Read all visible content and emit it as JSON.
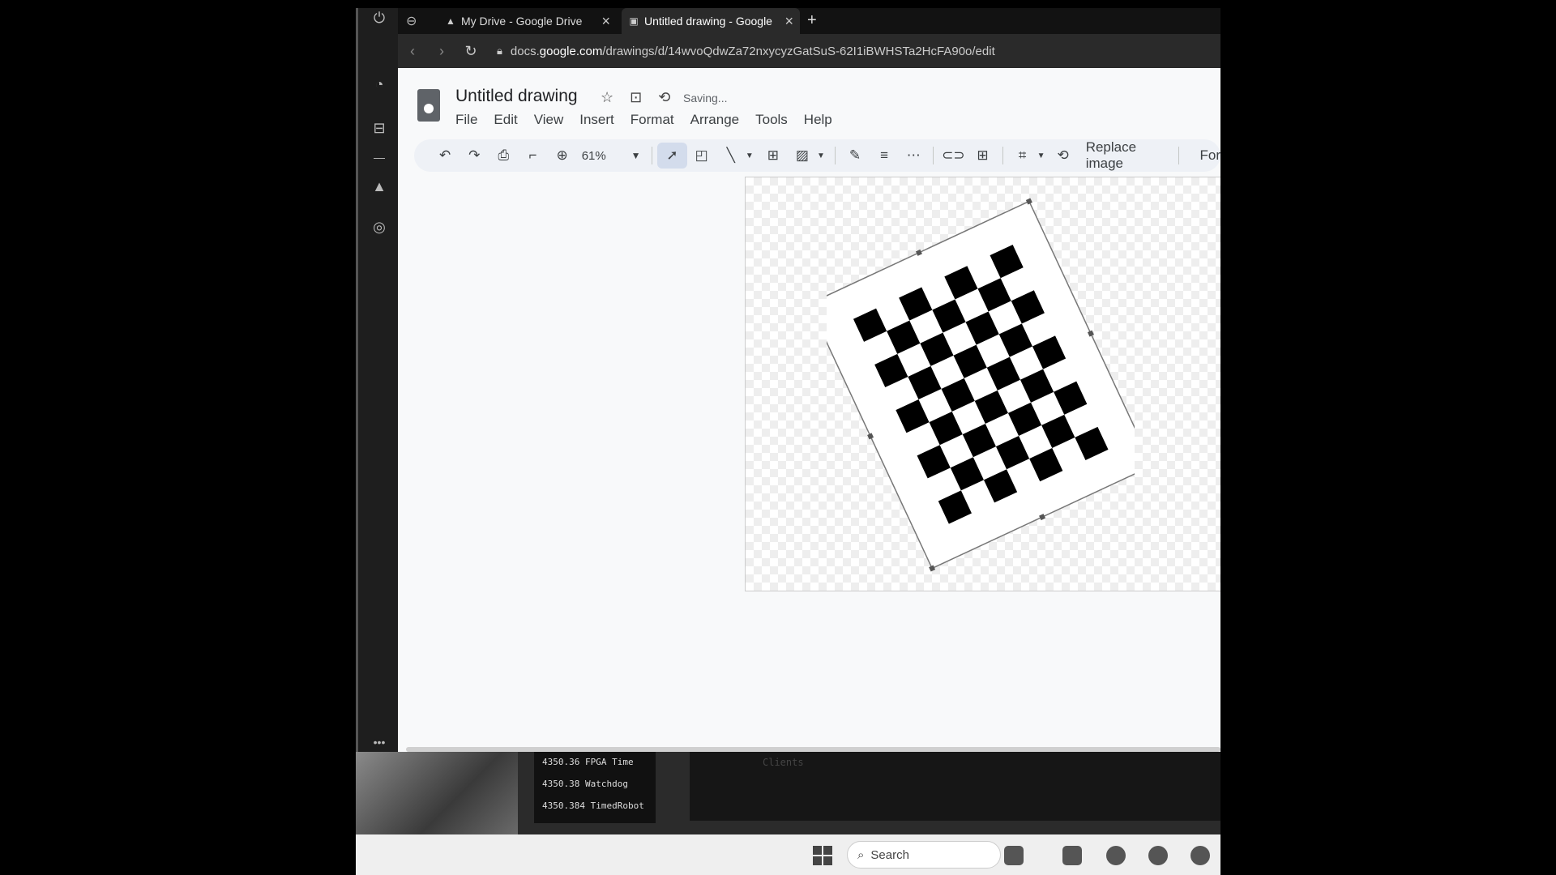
{
  "browser": {
    "tabs": [
      {
        "label": "My Drive - Google Drive"
      },
      {
        "label": "Untitled drawing - Google"
      }
    ],
    "url_prefix": "docs.",
    "url_domain": "google.com",
    "url_path": "/drawings/d/14wvoQdwZa72nxycyzGatSuS-62I1iBWHSTa2HcFA90o/edit"
  },
  "doc": {
    "title": "Untitled drawing",
    "status": "Saving...",
    "menus": [
      "File",
      "Edit",
      "View",
      "Insert",
      "Format",
      "Arrange",
      "Tools",
      "Help"
    ],
    "zoom": "61%",
    "replace_image": "Replace image",
    "format_options": "For"
  },
  "console": {
    "log": [
      {
        "time": "4350.36",
        "label": "FPGA Time"
      },
      {
        "time": "4350.38",
        "label": "Watchdog"
      },
      {
        "time": "4350.384",
        "label": "TimedRobot"
      }
    ],
    "clients": "Clients"
  },
  "taskbar": {
    "search_label": "Search"
  }
}
